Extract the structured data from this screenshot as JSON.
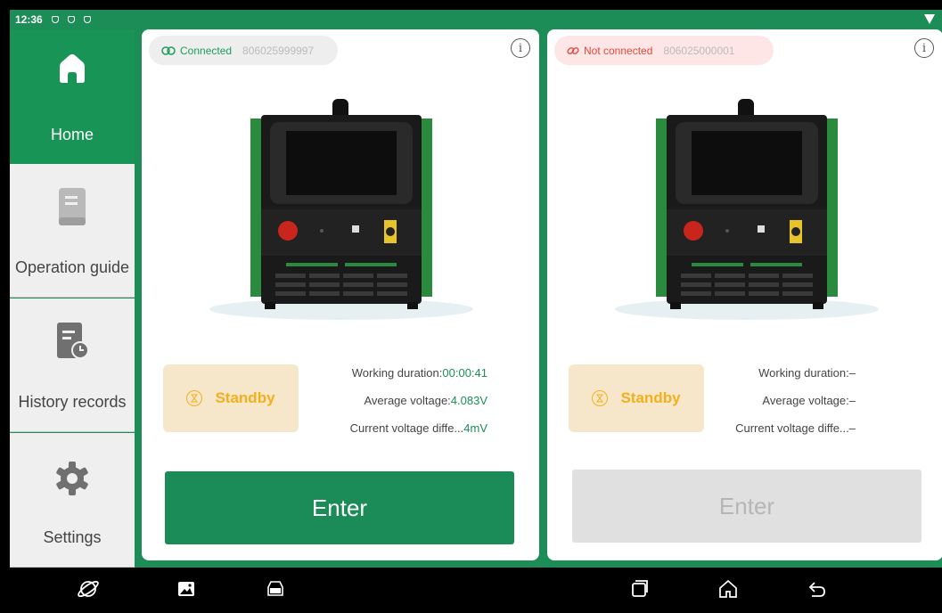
{
  "statusbar": {
    "time": "12:36"
  },
  "sidebar": {
    "items": [
      {
        "label": "Home",
        "icon": "home-icon",
        "active": true
      },
      {
        "label": "Operation guide",
        "icon": "book-icon",
        "active": false
      },
      {
        "label": "History records",
        "icon": "history-icon",
        "active": false
      },
      {
        "label": "Settings",
        "icon": "gear-icon",
        "active": false
      }
    ]
  },
  "devices": [
    {
      "connection": "Connected",
      "serial": "806025999997",
      "status": "Standby",
      "metrics": [
        {
          "label": "Working duration:",
          "value": "00:00:41"
        },
        {
          "label": "Average voltage:",
          "value": "4.083V"
        },
        {
          "label": "Current voltage diffe...",
          "value": "4mV"
        }
      ],
      "enter_label": "Enter",
      "enter_enabled": true
    },
    {
      "connection": "Not connected",
      "serial": "806025000001",
      "status": "Standby",
      "metrics": [
        {
          "label": "Working duration:",
          "value": "–"
        },
        {
          "label": "Average voltage:",
          "value": "–"
        },
        {
          "label": "Current voltage diffe...",
          "value": "–"
        }
      ],
      "enter_label": "Enter",
      "enter_enabled": false
    }
  ],
  "colors": {
    "brand_green": "#1d8d58",
    "status_amber": "#f3b01b",
    "error_red": "#e2483d"
  }
}
